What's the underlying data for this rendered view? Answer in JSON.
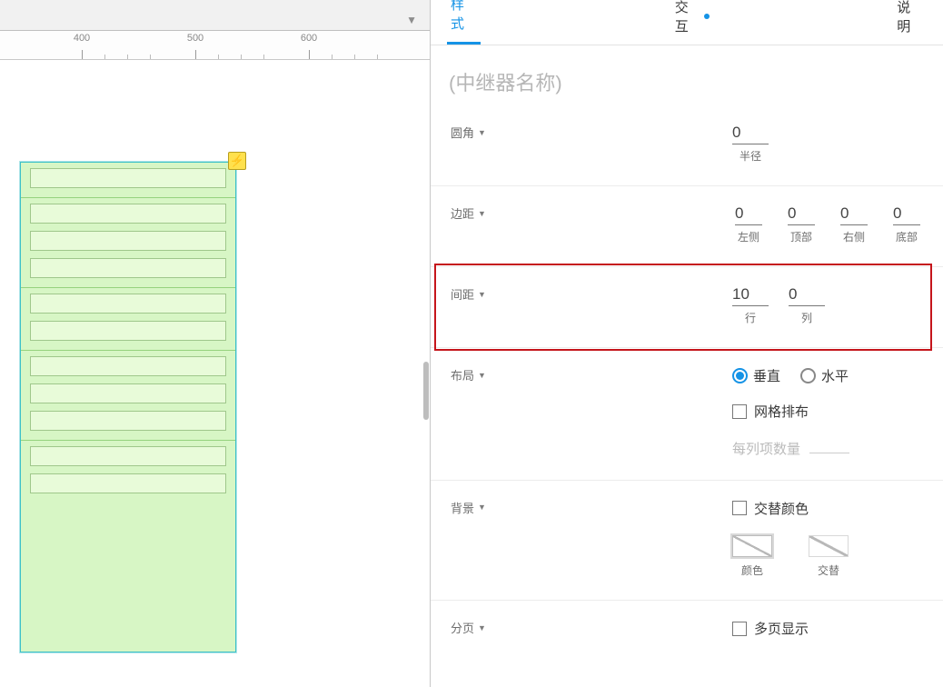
{
  "ruler": {
    "ticks": [
      "400",
      "500",
      "600"
    ]
  },
  "tabs": {
    "style": "样式",
    "interact": "交互",
    "notes": "说明"
  },
  "title_placeholder": "(中继器名称)",
  "sections": {
    "radius": {
      "label": "圆角",
      "value": "0",
      "unit": "半径"
    },
    "margin": {
      "label": "边距",
      "left": {
        "val": "0",
        "sub": "左侧"
      },
      "top": {
        "val": "0",
        "sub": "顶部"
      },
      "right": {
        "val": "0",
        "sub": "右侧"
      },
      "bottom": {
        "val": "0",
        "sub": "底部"
      }
    },
    "spacing": {
      "label": "间距",
      "row": {
        "val": "10",
        "sub": "行"
      },
      "col": {
        "val": "0",
        "sub": "列"
      }
    },
    "layout": {
      "label": "布局",
      "vertical": "垂直",
      "horizontal": "水平",
      "grid": "网格排布",
      "per_col_label": "每列项数量"
    },
    "background": {
      "label": "背景",
      "alternate": "交替颜色",
      "color_sub": "颜色",
      "alt_sub": "交替"
    },
    "pagination": {
      "label": "分页",
      "multi": "多页显示"
    }
  },
  "icons": {
    "lightning": "⚡"
  }
}
